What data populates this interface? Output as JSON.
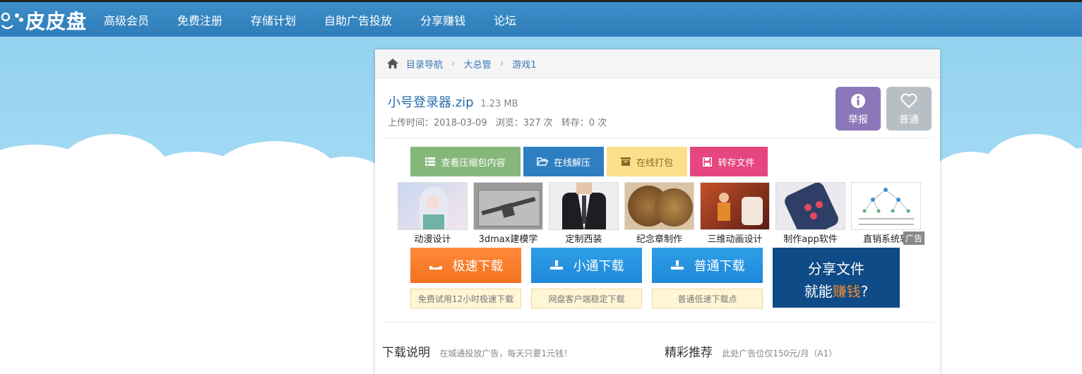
{
  "logo": {
    "text": "皮皮盘"
  },
  "nav": [
    "高级会员",
    "免费注册",
    "存储计划",
    "自助广告投放",
    "分享赚钱",
    "论坛"
  ],
  "breadcrumb": [
    "目录导航",
    "大总管",
    "游戏1"
  ],
  "file": {
    "name": "小号登录器.zip",
    "size": "1.23 MB",
    "upload": "上传时间：2018-03-09",
    "views": "浏览：327 次",
    "saves": "转存：0 次"
  },
  "side_buttons": {
    "report": "举报",
    "normal": "普通"
  },
  "tools": [
    "查看压缩包内容",
    "在线解压",
    "在线打包",
    "转存文件"
  ],
  "ads": [
    "动漫设计",
    "3dmax建模学",
    "定制西装",
    "纪念章制作",
    "三维动画设计",
    "制作app软件",
    "直销系统软"
  ],
  "ad_tag": "广告",
  "downloads": [
    {
      "label": "极速下载",
      "note": "免费试用12小时极速下载"
    },
    {
      "label": "小通下载",
      "note": "网盘客户端稳定下载"
    },
    {
      "label": "普通下载",
      "note": "普通低速下载点"
    }
  ],
  "share": {
    "line1": "分享文件",
    "line2_a": "就能",
    "line2_b": "赚钱",
    "line2_c": "?"
  },
  "sections": {
    "left_title": "下载说明",
    "left_sub": "在城通投放广告，每天只要1元钱！",
    "right_title": "精彩推荐",
    "right_sub": "此处广告位仅150元/月（A1）"
  },
  "colors": {
    "nav": "#2f7dba",
    "orange": "#f2721f",
    "blue": "#1e88d8",
    "share": "#0f4b86",
    "accent": "#f08a2c"
  },
  "icons": [
    "home-icon",
    "info-icon",
    "heart-icon",
    "list-icon",
    "folder-open-icon",
    "box-icon",
    "save-icon",
    "download-tray-icon"
  ]
}
